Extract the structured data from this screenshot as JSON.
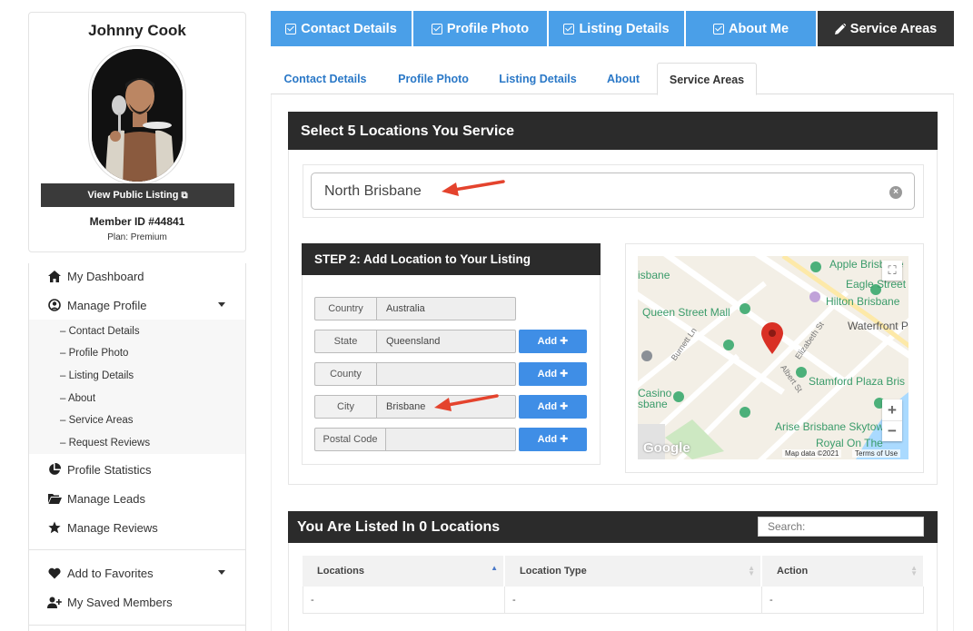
{
  "profile": {
    "name": "Johnny Cook",
    "view_public": "View Public Listing",
    "member_id": "Member ID #44841",
    "plan": "Plan: Premium"
  },
  "sidebar": {
    "items": [
      {
        "label": "My Dashboard",
        "icon": "home-icon"
      },
      {
        "label": "Manage Profile",
        "icon": "user-circle-icon"
      },
      {
        "label": "Profile Statistics",
        "icon": "pie-chart-icon"
      },
      {
        "label": "Manage Leads",
        "icon": "folder-open-icon"
      },
      {
        "label": "Manage Reviews",
        "icon": "star-icon"
      },
      {
        "label": "Add to Favorites",
        "icon": "heart-icon"
      },
      {
        "label": "My Saved Members",
        "icon": "user-plus-icon"
      }
    ],
    "sub_items": [
      "– Contact Details",
      "– Profile Photo",
      "– Listing Details",
      "– About",
      "– Service Areas",
      "– Request Reviews"
    ]
  },
  "top_tabs": [
    {
      "label": "Contact Details",
      "icon": "check-square-icon"
    },
    {
      "label": "Profile Photo",
      "icon": "check-square-icon"
    },
    {
      "label": "Listing Details",
      "icon": "check-square-icon"
    },
    {
      "label": "About Me",
      "icon": "check-square-icon"
    },
    {
      "label": "Service Areas",
      "icon": "pencil-icon"
    }
  ],
  "sub_tabs": [
    "Contact Details",
    "Profile Photo",
    "Listing Details",
    "About",
    "Service Areas"
  ],
  "select_section": {
    "title": "Select 5 Locations You Service",
    "search_value": "North Brisbane"
  },
  "step2": {
    "title": "STEP 2: Add Location to Your Listing",
    "add_label": "Add ✚",
    "fields": [
      {
        "label": "Country",
        "value": "Australia"
      },
      {
        "label": "State",
        "value": "Queensland"
      },
      {
        "label": "County",
        "value": ""
      },
      {
        "label": "City",
        "value": "Brisbane"
      },
      {
        "label": "Postal Code",
        "value": ""
      }
    ]
  },
  "map": {
    "labels": {
      "apple": "Apple Brisbane",
      "eagle": "Eagle Street",
      "hilton": "Hilton Brisbane",
      "isbane": "isbane",
      "queen": "Queen Street Mall",
      "waterfront": "Waterfront P",
      "burnett": "Burnett Ln",
      "elizabeth": "Elizabeth St",
      "albert": "Albert St",
      "stamford": "Stamford Plaza Bris",
      "casino": "Casino\nsbane",
      "arise": "Arise Brisbane Skytow",
      "royal": "Royal On The"
    },
    "zoom_in": "+",
    "zoom_out": "−",
    "fullscreen": "⛶",
    "google": "Google",
    "map_data": "Map data ©2021",
    "terms": "Terms of Use"
  },
  "listed": {
    "title": "You Are Listed In 0 Locations",
    "search_placeholder": "Search:",
    "columns": [
      "Locations",
      "Location Type",
      "Action"
    ],
    "row": [
      "-",
      "-",
      "-"
    ]
  },
  "colors": {
    "tab_blue": "#4a9fe8",
    "dark": "#2b2b2b",
    "link_blue": "#2a78c7",
    "button_blue": "#3f8ee6",
    "arrow_red": "#e4432d"
  }
}
